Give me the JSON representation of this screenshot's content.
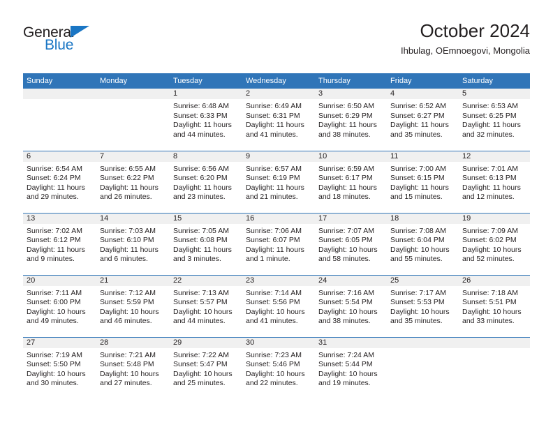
{
  "brand": {
    "name_part1": "General",
    "name_part2": "Blue",
    "triangle_icon": "brand-triangle-icon",
    "accent_color": "#1a76c4"
  },
  "header": {
    "title": "October 2024",
    "subtitle": "Ihbulag, OEmnoegovi, Mongolia"
  },
  "theme": {
    "header_blue": "#3075b8",
    "daynum_band": "#f0f0f0",
    "text": "#231f20"
  },
  "calendar": {
    "weekday_headers": [
      "Sunday",
      "Monday",
      "Tuesday",
      "Wednesday",
      "Thursday",
      "Friday",
      "Saturday"
    ],
    "weeks": [
      [
        {
          "day": "",
          "sunrise": "",
          "sunset": "",
          "daylight": ""
        },
        {
          "day": "",
          "sunrise": "",
          "sunset": "",
          "daylight": ""
        },
        {
          "day": "1",
          "sunrise": "Sunrise: 6:48 AM",
          "sunset": "Sunset: 6:33 PM",
          "daylight": "Daylight: 11 hours and 44 minutes."
        },
        {
          "day": "2",
          "sunrise": "Sunrise: 6:49 AM",
          "sunset": "Sunset: 6:31 PM",
          "daylight": "Daylight: 11 hours and 41 minutes."
        },
        {
          "day": "3",
          "sunrise": "Sunrise: 6:50 AM",
          "sunset": "Sunset: 6:29 PM",
          "daylight": "Daylight: 11 hours and 38 minutes."
        },
        {
          "day": "4",
          "sunrise": "Sunrise: 6:52 AM",
          "sunset": "Sunset: 6:27 PM",
          "daylight": "Daylight: 11 hours and 35 minutes."
        },
        {
          "day": "5",
          "sunrise": "Sunrise: 6:53 AM",
          "sunset": "Sunset: 6:25 PM",
          "daylight": "Daylight: 11 hours and 32 minutes."
        }
      ],
      [
        {
          "day": "6",
          "sunrise": "Sunrise: 6:54 AM",
          "sunset": "Sunset: 6:24 PM",
          "daylight": "Daylight: 11 hours and 29 minutes."
        },
        {
          "day": "7",
          "sunrise": "Sunrise: 6:55 AM",
          "sunset": "Sunset: 6:22 PM",
          "daylight": "Daylight: 11 hours and 26 minutes."
        },
        {
          "day": "8",
          "sunrise": "Sunrise: 6:56 AM",
          "sunset": "Sunset: 6:20 PM",
          "daylight": "Daylight: 11 hours and 23 minutes."
        },
        {
          "day": "9",
          "sunrise": "Sunrise: 6:57 AM",
          "sunset": "Sunset: 6:19 PM",
          "daylight": "Daylight: 11 hours and 21 minutes."
        },
        {
          "day": "10",
          "sunrise": "Sunrise: 6:59 AM",
          "sunset": "Sunset: 6:17 PM",
          "daylight": "Daylight: 11 hours and 18 minutes."
        },
        {
          "day": "11",
          "sunrise": "Sunrise: 7:00 AM",
          "sunset": "Sunset: 6:15 PM",
          "daylight": "Daylight: 11 hours and 15 minutes."
        },
        {
          "day": "12",
          "sunrise": "Sunrise: 7:01 AM",
          "sunset": "Sunset: 6:13 PM",
          "daylight": "Daylight: 11 hours and 12 minutes."
        }
      ],
      [
        {
          "day": "13",
          "sunrise": "Sunrise: 7:02 AM",
          "sunset": "Sunset: 6:12 PM",
          "daylight": "Daylight: 11 hours and 9 minutes."
        },
        {
          "day": "14",
          "sunrise": "Sunrise: 7:03 AM",
          "sunset": "Sunset: 6:10 PM",
          "daylight": "Daylight: 11 hours and 6 minutes."
        },
        {
          "day": "15",
          "sunrise": "Sunrise: 7:05 AM",
          "sunset": "Sunset: 6:08 PM",
          "daylight": "Daylight: 11 hours and 3 minutes."
        },
        {
          "day": "16",
          "sunrise": "Sunrise: 7:06 AM",
          "sunset": "Sunset: 6:07 PM",
          "daylight": "Daylight: 11 hours and 1 minute."
        },
        {
          "day": "17",
          "sunrise": "Sunrise: 7:07 AM",
          "sunset": "Sunset: 6:05 PM",
          "daylight": "Daylight: 10 hours and 58 minutes."
        },
        {
          "day": "18",
          "sunrise": "Sunrise: 7:08 AM",
          "sunset": "Sunset: 6:04 PM",
          "daylight": "Daylight: 10 hours and 55 minutes."
        },
        {
          "day": "19",
          "sunrise": "Sunrise: 7:09 AM",
          "sunset": "Sunset: 6:02 PM",
          "daylight": "Daylight: 10 hours and 52 minutes."
        }
      ],
      [
        {
          "day": "20",
          "sunrise": "Sunrise: 7:11 AM",
          "sunset": "Sunset: 6:00 PM",
          "daylight": "Daylight: 10 hours and 49 minutes."
        },
        {
          "day": "21",
          "sunrise": "Sunrise: 7:12 AM",
          "sunset": "Sunset: 5:59 PM",
          "daylight": "Daylight: 10 hours and 46 minutes."
        },
        {
          "day": "22",
          "sunrise": "Sunrise: 7:13 AM",
          "sunset": "Sunset: 5:57 PM",
          "daylight": "Daylight: 10 hours and 44 minutes."
        },
        {
          "day": "23",
          "sunrise": "Sunrise: 7:14 AM",
          "sunset": "Sunset: 5:56 PM",
          "daylight": "Daylight: 10 hours and 41 minutes."
        },
        {
          "day": "24",
          "sunrise": "Sunrise: 7:16 AM",
          "sunset": "Sunset: 5:54 PM",
          "daylight": "Daylight: 10 hours and 38 minutes."
        },
        {
          "day": "25",
          "sunrise": "Sunrise: 7:17 AM",
          "sunset": "Sunset: 5:53 PM",
          "daylight": "Daylight: 10 hours and 35 minutes."
        },
        {
          "day": "26",
          "sunrise": "Sunrise: 7:18 AM",
          "sunset": "Sunset: 5:51 PM",
          "daylight": "Daylight: 10 hours and 33 minutes."
        }
      ],
      [
        {
          "day": "27",
          "sunrise": "Sunrise: 7:19 AM",
          "sunset": "Sunset: 5:50 PM",
          "daylight": "Daylight: 10 hours and 30 minutes."
        },
        {
          "day": "28",
          "sunrise": "Sunrise: 7:21 AM",
          "sunset": "Sunset: 5:48 PM",
          "daylight": "Daylight: 10 hours and 27 minutes."
        },
        {
          "day": "29",
          "sunrise": "Sunrise: 7:22 AM",
          "sunset": "Sunset: 5:47 PM",
          "daylight": "Daylight: 10 hours and 25 minutes."
        },
        {
          "day": "30",
          "sunrise": "Sunrise: 7:23 AM",
          "sunset": "Sunset: 5:46 PM",
          "daylight": "Daylight: 10 hours and 22 minutes."
        },
        {
          "day": "31",
          "sunrise": "Sunrise: 7:24 AM",
          "sunset": "Sunset: 5:44 PM",
          "daylight": "Daylight: 10 hours and 19 minutes."
        },
        {
          "day": "",
          "sunrise": "",
          "sunset": "",
          "daylight": ""
        },
        {
          "day": "",
          "sunrise": "",
          "sunset": "",
          "daylight": ""
        }
      ]
    ]
  }
}
